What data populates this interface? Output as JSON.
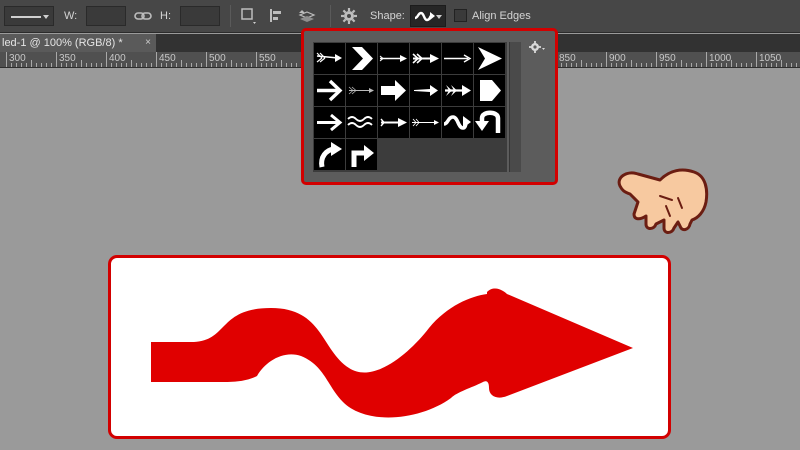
{
  "options_bar": {
    "w_label": "W:",
    "h_label": "H:",
    "shape_label": "Shape:",
    "align_edges_label": "Align Edges",
    "align_edges_checked": false
  },
  "document_tab": {
    "title": "led-1 @ 100% (RGB/8) *",
    "close": "×"
  },
  "ruler": {
    "labels": [
      "300",
      "350",
      "400",
      "450",
      "500",
      "550",
      "850",
      "900",
      "950",
      "1000",
      "1050"
    ]
  },
  "shape_picker": {
    "shapes": [
      "arrow-feathered-shaft",
      "chevron-large",
      "arrow-thin-long",
      "arrow-tailed",
      "arrow-thin-simple",
      "arrowhead-large",
      "arrow-bold",
      "arrow-feathered-thin",
      "arrow-block",
      "arrow-tapered",
      "arrow-double-tail",
      "arrow-pentagon",
      "arrow-medium",
      "wave-line",
      "arrow-long-point",
      "arrow-feathered-long",
      "arrow-wavy",
      "arrow-u-turn",
      "arrow-curved-up",
      "arrow-turn-right"
    ],
    "selected": "arrow-wavy",
    "gear_icon": "gear-icon"
  },
  "result_preview": {
    "shape": "arrow-wavy",
    "fill_color": "#e00000"
  },
  "colors": {
    "highlight": "#d20000",
    "canvas_bg": "#9a9a9a",
    "toolbar_bg": "#474747"
  }
}
